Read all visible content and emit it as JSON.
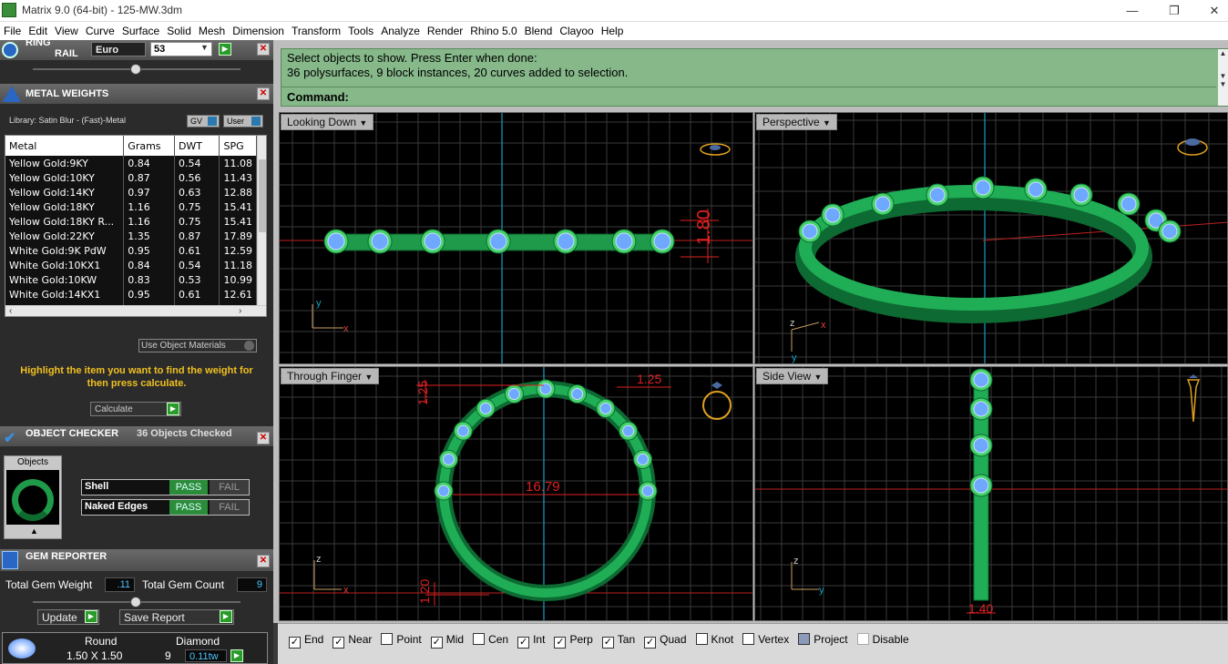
{
  "window": {
    "title": "Matrix 9.0 (64-bit) - 125-MW.3dm",
    "min": "—",
    "max": "❐",
    "close": "✕"
  },
  "menu": [
    "File",
    "Edit",
    "View",
    "Curve",
    "Surface",
    "Solid",
    "Mesh",
    "Dimension",
    "Transform",
    "Tools",
    "Analyze",
    "Render",
    "Rhino 5.0",
    "Blend",
    "Clayoo",
    "Help"
  ],
  "ring_rail": {
    "title": "RING\nRAIL",
    "title1": "RING",
    "title2": "RAIL",
    "size_system": "Euro",
    "size_value": "53"
  },
  "metal_weights": {
    "title": "METAL WEIGHTS",
    "library": "Library: Satin Blur - (Fast)-Metal",
    "gv": "GV",
    "user": "User",
    "columns": [
      "Metal",
      "Grams",
      "DWT",
      "SPG"
    ],
    "rows": [
      [
        "Yellow Gold:9KY",
        "0.84",
        "0.54",
        "11.08"
      ],
      [
        "Yellow Gold:10KY",
        "0.87",
        "0.56",
        "11.43"
      ],
      [
        "Yellow Gold:14KY",
        "0.97",
        "0.63",
        "12.88"
      ],
      [
        "Yellow Gold:18KY",
        "1.16",
        "0.75",
        "15.41"
      ],
      [
        "Yellow Gold:18KY R...",
        "1.16",
        "0.75",
        "15.41"
      ],
      [
        "Yellow Gold:22KY",
        "1.35",
        "0.87",
        "17.89"
      ],
      [
        "White Gold:9K PdW",
        "0.95",
        "0.61",
        "12.59"
      ],
      [
        "White Gold:10KX1",
        "0.84",
        "0.54",
        "11.18"
      ],
      [
        "White Gold:10KW",
        "0.83",
        "0.53",
        "10.99"
      ],
      [
        "White Gold:14KX1",
        "0.95",
        "0.61",
        "12.61"
      ],
      [
        "White Gold:14K PdW",
        "1.09",
        "0.70",
        "14.37"
      ]
    ],
    "use_object_materials": "Use Object Materials",
    "hint": "Highlight the item you want to find the weight for then press calculate.",
    "calculate": "Calculate"
  },
  "object_checker": {
    "title": "OBJECT CHECKER",
    "status": "36  Objects Checked",
    "objects_label": "Objects",
    "checks": [
      {
        "name": "Shell",
        "pass": "PASS",
        "fail": "FAIL"
      },
      {
        "name": "Naked Edges",
        "pass": "PASS",
        "fail": "FAIL"
      }
    ]
  },
  "gem_reporter": {
    "title": "GEM REPORTER",
    "total_weight_label": "Total Gem Weight",
    "total_weight": ".11",
    "total_count_label": "Total Gem Count",
    "total_count": "9",
    "update": "Update",
    "save_report": "Save Report",
    "shape": "Round",
    "size": "1.50 X 1.50",
    "material": "Diamond",
    "qty": "9",
    "weight": "0.11tw"
  },
  "command": {
    "line1": "Select objects to show. Press Enter when done:",
    "line2": "36 polysurfaces, 9 block instances, 20 curves added to selection.",
    "prompt": "Command:"
  },
  "viewports": {
    "top_left": {
      "label": "Looking Down",
      "dim": "1.80",
      "axis_x": "x",
      "axis_y": "y"
    },
    "top_right": {
      "label": "Perspective",
      "axis_x": "x",
      "axis_y": "y",
      "axis_z": "z"
    },
    "bottom_left": {
      "label": "Through Finger",
      "dim_main": "16.79",
      "dim_a": "1.25",
      "dim_b": "1.25",
      "dim_c": "1.20",
      "axis_x": "x",
      "axis_z": "z"
    },
    "bottom_right": {
      "label": "Side View",
      "dim": "1.40",
      "axis_y": "y",
      "axis_z": "z"
    }
  },
  "snaps": [
    {
      "label": "End",
      "checked": true
    },
    {
      "label": "Near",
      "checked": true
    },
    {
      "label": "Point",
      "checked": false
    },
    {
      "label": "Mid",
      "checked": true
    },
    {
      "label": "Cen",
      "checked": false
    },
    {
      "label": "Int",
      "checked": true
    },
    {
      "label": "Perp",
      "checked": true
    },
    {
      "label": "Tan",
      "checked": true
    },
    {
      "label": "Quad",
      "checked": true
    },
    {
      "label": "Knot",
      "checked": false
    },
    {
      "label": "Vertex",
      "checked": false
    },
    {
      "label": "Project",
      "checked": false
    },
    {
      "label": "Disable",
      "checked": false
    }
  ],
  "colors": {
    "command_bg": "#86b88a",
    "ring_green": "#1f9a4a",
    "gem_blue": "#6fa8ff",
    "dim_red": "#e02020",
    "grid": "#3a3a3a",
    "axis_cyan": "#18a0c0"
  }
}
